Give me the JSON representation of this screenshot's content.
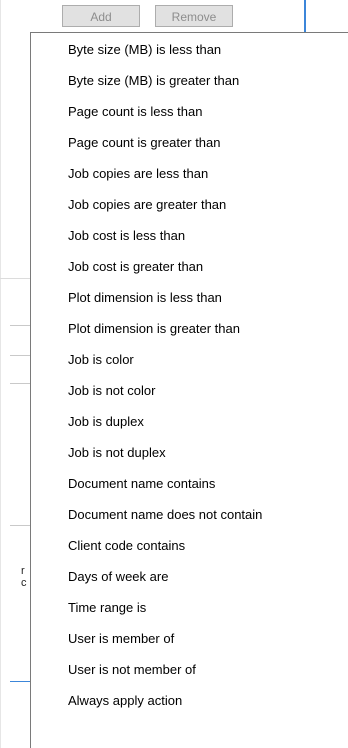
{
  "toolbar": {
    "add_label": "Add",
    "remove_label": "Remove"
  },
  "background": {
    "fragment_line1": "r",
    "fragment_line2": "c"
  },
  "menu": {
    "items": [
      "Byte size (MB) is less than",
      "Byte size (MB) is greater than",
      "Page count is less than",
      "Page count is greater than",
      "Job copies are less than",
      "Job copies are greater than",
      "Job cost is less than",
      "Job cost is greater than",
      "Plot dimension is less than",
      "Plot dimension is greater than",
      "Job is color",
      "Job is not color",
      "Job is duplex",
      "Job is not duplex",
      "Document name contains",
      "Document name does not contain",
      "Client code contains",
      "Days of week are",
      "Time range is",
      "User is member of",
      "User is not member of",
      "Always apply action"
    ]
  },
  "colors": {
    "menu_border": "#7a7a7a",
    "button_face": "#e1e1e1",
    "disabled_text": "#8d8d8d",
    "accent_blue": "#3c86d9"
  }
}
